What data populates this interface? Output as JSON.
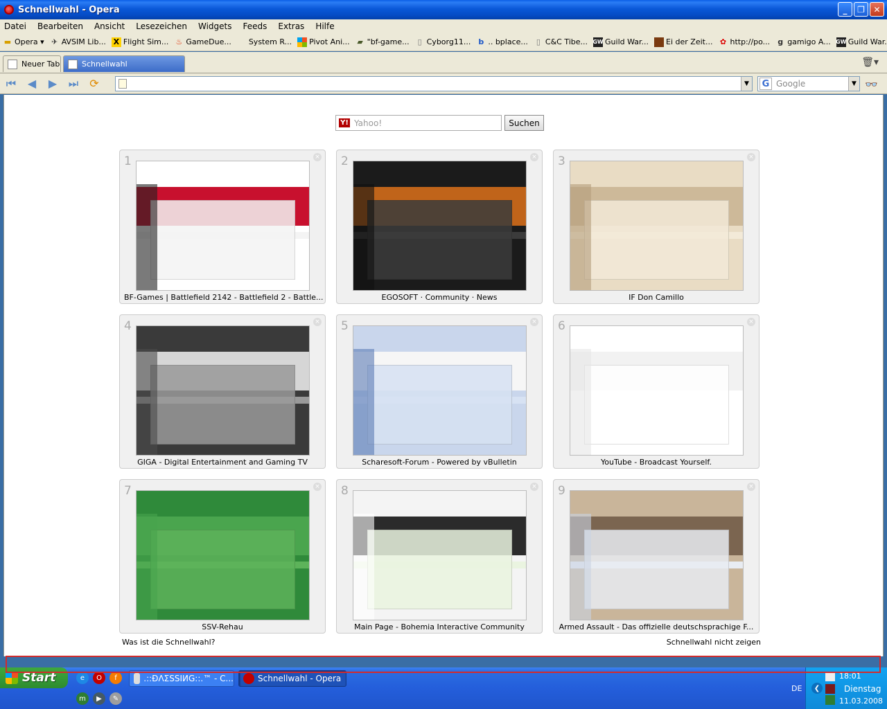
{
  "window": {
    "title": "Schnellwahl - Opera",
    "controls": [
      "minimize",
      "maximize",
      "close"
    ]
  },
  "menu": [
    "Datei",
    "Bearbeiten",
    "Ansicht",
    "Lesezeichen",
    "Widgets",
    "Feeds",
    "Extras",
    "Hilfe"
  ],
  "bookmarks": [
    {
      "label": "Opera ▾",
      "icon": "folder-icon"
    },
    {
      "label": "AVSIM Lib...",
      "icon": "plane-icon"
    },
    {
      "label": "Flight Sim...",
      "icon": "x-logo-icon"
    },
    {
      "label": "GameDue...",
      "icon": "flame-icon"
    },
    {
      "label": "System R...",
      "icon": "blank-icon"
    },
    {
      "label": "Pivot Ani...",
      "icon": "windows-icon"
    },
    {
      "label": "\"bf-game...",
      "icon": "tank-icon"
    },
    {
      "label": "Cyborg11...",
      "icon": "page-icon"
    },
    {
      "label": ".. bplace...",
      "icon": "b-logo-icon"
    },
    {
      "label": "C&C Tibe...",
      "icon": "pages-icon"
    },
    {
      "label": "Guild War...",
      "icon": "gw-icon"
    },
    {
      "label": "Ei der Zeit...",
      "icon": "book-icon"
    },
    {
      "label": "http://po...",
      "icon": "flower-icon"
    },
    {
      "label": "gamigo A...",
      "icon": "g-logo-icon"
    },
    {
      "label": "Guild War...",
      "icon": "gw-icon"
    }
  ],
  "tabs": [
    {
      "label": "Neuer Tab",
      "active": false
    },
    {
      "label": "Schnellwahl",
      "active": true
    }
  ],
  "search": {
    "engine": "Google",
    "placeholder": "Google"
  },
  "speeddial": {
    "search_placeholder": "Yahoo!",
    "search_button": "Suchen",
    "items": [
      {
        "num": "1",
        "title": "BF-Games | Battlefield 2142 - Battlefield 2 - Battle...",
        "colors": [
          "#ffffff",
          "#c8102e",
          "#f4f4f4",
          "#222222"
        ]
      },
      {
        "num": "2",
        "title": "EGOSOFT · Community · News",
        "colors": [
          "#1b1b1b",
          "#c0641a",
          "#3b3b3b",
          "#111111"
        ]
      },
      {
        "num": "3",
        "title": "IF Don Camillo",
        "colors": [
          "#e9dcc4",
          "#cdb999",
          "#f3ead8",
          "#b49d7b"
        ]
      },
      {
        "num": "4",
        "title": "GIGA - Digital Entertainment and Gaming TV",
        "colors": [
          "#3a3a3a",
          "#d6d6d6",
          "#9a9a9a",
          "#4b4b4b"
        ]
      },
      {
        "num": "5",
        "title": "Scharesoft-Forum - Powered by vBulletin",
        "colors": [
          "#c9d6ec",
          "#f6f6f6",
          "#d7e2f3",
          "#5b7bb5"
        ]
      },
      {
        "num": "6",
        "title": "YouTube - Broadcast Yourself.",
        "colors": [
          "#ffffff",
          "#f2f2f2",
          "#ffffff",
          "#e6e6e6"
        ]
      },
      {
        "num": "7",
        "title": "SSV-Rehau",
        "colors": [
          "#2f8a3a",
          "#4aa54e",
          "#5db35a",
          "#48a34c"
        ]
      },
      {
        "num": "8",
        "title": "Main Page - Bohemia Interactive Community",
        "colors": [
          "#f4f4f4",
          "#2b2b2b",
          "#eaf4e0",
          "#ffffff"
        ]
      },
      {
        "num": "9",
        "title": "Armed Assault - Das offizielle deutschsprachige F...",
        "colors": [
          "#c9b59a",
          "#7b6550",
          "#e8ecf2",
          "#c9d3e2"
        ]
      }
    ],
    "footer_left": "Was ist die Schnellwahl?",
    "footer_right": "Schnellwahl nicht zeigen"
  },
  "taskbar": {
    "start": "Start",
    "buttons": [
      {
        "label": ".::ÐΛΣSSIИG::.™ - C..."
      },
      {
        "label": "Schnellwahl - Opera"
      }
    ],
    "language": "DE",
    "time": "18:01",
    "day": "Dienstag",
    "date": "11.03.2008"
  }
}
